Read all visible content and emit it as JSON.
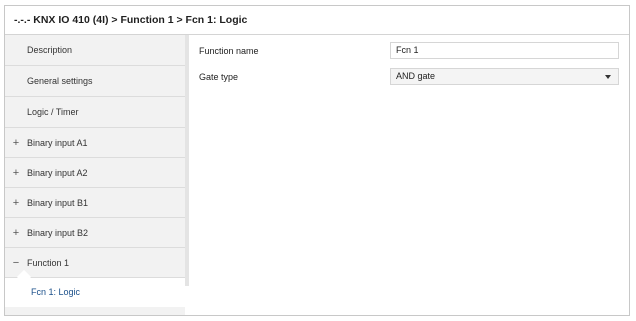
{
  "window": {
    "title": "-.-.- KNX IO 410 (4I) > Function 1 > Fcn 1: Logic"
  },
  "sidebar": {
    "items": [
      {
        "label": "Description",
        "sign": ""
      },
      {
        "label": "General settings",
        "sign": ""
      },
      {
        "label": "Logic / Timer",
        "sign": ""
      },
      {
        "label": "Binary input A1",
        "sign": "+"
      },
      {
        "label": "Binary input A2",
        "sign": "+"
      },
      {
        "label": "Binary input B1",
        "sign": "+"
      },
      {
        "label": "Binary input B2",
        "sign": "+"
      },
      {
        "label": "Function 1",
        "sign": "−"
      }
    ],
    "selected_child": {
      "label": "Fcn 1: Logic"
    }
  },
  "form": {
    "function_name": {
      "label": "Function name",
      "value": "Fcn 1"
    },
    "gate_type": {
      "label": "Gate type",
      "value": "AND gate",
      "icon": "chevron-down-icon"
    }
  },
  "colors": {
    "selected_text": "#1a4f8a",
    "sidebar_bg": "#f2f2f2"
  }
}
